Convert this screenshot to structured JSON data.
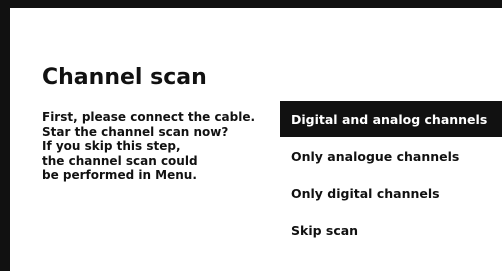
{
  "title": "Channel scan",
  "intro_lines": [
    "First, please connect the cable.",
    "Star the channel scan now?",
    "If you skip this step,",
    "the channel scan could",
    "be performed in Menu."
  ],
  "options": [
    {
      "label": "Digital and analog channels",
      "selected": true
    },
    {
      "label": "Only analogue channels",
      "selected": false
    },
    {
      "label": "Only digital channels",
      "selected": false
    },
    {
      "label": "Skip scan",
      "selected": false
    }
  ],
  "colors": {
    "frame": "#111111",
    "background": "#ffffff",
    "highlight": "#111111",
    "highlight_text": "#ffffff",
    "text": "#111111"
  }
}
